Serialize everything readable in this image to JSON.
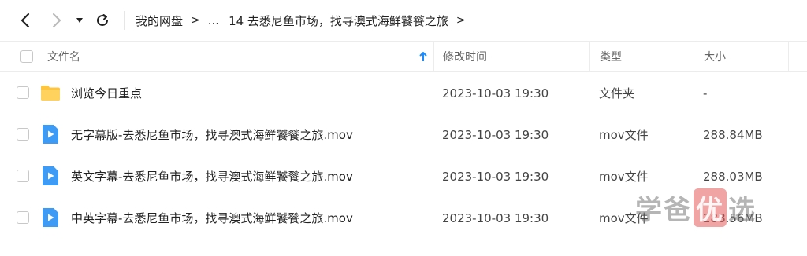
{
  "toolbar": {
    "breadcrumb": {
      "root": "我的网盘",
      "ellipsis": "...",
      "current": "14 去悉尼鱼市场，找寻澳式海鲜饕餮之旅",
      "separator": ">"
    }
  },
  "columns": {
    "name": "文件名",
    "modified": "修改时间",
    "type": "类型",
    "size": "大小"
  },
  "rows": [
    {
      "name": "浏览今日重点",
      "modified": "2023-10-03 19:30",
      "type": "文件夹",
      "size": "-",
      "icon": "folder-icon"
    },
    {
      "name": "无字幕版-去悉尼鱼市场，找寻澳式海鲜饕餮之旅.mov",
      "modified": "2023-10-03 19:30",
      "type": "mov文件",
      "size": "288.84MB",
      "icon": "video-file-icon"
    },
    {
      "name": "英文字幕-去悉尼鱼市场，找寻澳式海鲜饕餮之旅.mov",
      "modified": "2023-10-03 19:30",
      "type": "mov文件",
      "size": "288.03MB",
      "icon": "video-file-icon"
    },
    {
      "name": "中英字幕-去悉尼鱼市场，找寻澳式海鲜饕餮之旅.mov",
      "modified": "2023-10-03 19:30",
      "type": "mov文件",
      "size": "288.56MB",
      "icon": "video-file-icon"
    }
  ],
  "watermark": {
    "part1": "学爸",
    "accent": "优",
    "part2": "选"
  },
  "colors": {
    "accent_blue": "#1a8cff",
    "folder_yellow": "#ffc53d",
    "video_blue": "#3d9bf5"
  }
}
